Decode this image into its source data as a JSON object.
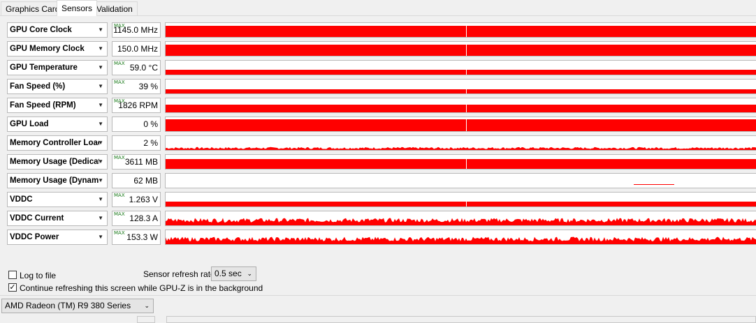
{
  "tabs": [
    {
      "label": "Graphics Card",
      "active": false
    },
    {
      "label": "Sensors",
      "active": true
    },
    {
      "label": "Validation",
      "active": false
    }
  ],
  "colors": {
    "graph": "#ff0000",
    "max_tag": "#1a7a1a"
  },
  "sensors": [
    {
      "name": "GPU Core Clock",
      "value": "1145.0 MHz",
      "max_tag": "MAX",
      "level": 0.8,
      "pattern": "flat"
    },
    {
      "name": "GPU Memory Clock",
      "value": "150.0 MHz",
      "max_tag": "",
      "level": 0.8,
      "pattern": "flat"
    },
    {
      "name": "GPU Temperature",
      "value": "59.0 °C",
      "max_tag": "MAX",
      "level": 0.4,
      "pattern": "flat"
    },
    {
      "name": "Fan Speed (%)",
      "value": "39 %",
      "max_tag": "MAX",
      "level": 0.35,
      "pattern": "flat"
    },
    {
      "name": "Fan Speed (RPM)",
      "value": "1826 RPM",
      "max_tag": "MAX",
      "level": 0.55,
      "pattern": "flat"
    },
    {
      "name": "GPU Load",
      "value": "0 %",
      "max_tag": "",
      "level": 0.88,
      "pattern": "flat"
    },
    {
      "name": "Memory Controller Load",
      "value": "2 %",
      "max_tag": "",
      "level": 0.25,
      "pattern": "noisy"
    },
    {
      "name": "Memory Usage (Dedicated)",
      "value": "3611 MB",
      "max_tag": "MAX",
      "level": 0.7,
      "pattern": "flat"
    },
    {
      "name": "Memory Usage (Dynamic)",
      "value": "62 MB",
      "max_tag": "",
      "level": 0.05,
      "pattern": "blip"
    },
    {
      "name": "VDDC",
      "value": "1.263 V",
      "max_tag": "MAX",
      "level": 0.4,
      "pattern": "flat"
    },
    {
      "name": "VDDC Current",
      "value": "128.3 A",
      "max_tag": "MAX",
      "level": 0.55,
      "pattern": "noisy"
    },
    {
      "name": "VDDC Power",
      "value": "153.3 W",
      "max_tag": "MAX",
      "level": 0.55,
      "pattern": "noisy"
    }
  ],
  "log_to_file": {
    "label": "Log to file",
    "checked": false
  },
  "refresh_rate": {
    "label": "Sensor refresh rate:",
    "value": "0.5 sec"
  },
  "background_refresh": {
    "label": "Continue refreshing this screen while GPU-Z is in the background",
    "checked": true
  },
  "gpu_select": {
    "value": "AMD Radeon (TM) R9 380 Series"
  }
}
